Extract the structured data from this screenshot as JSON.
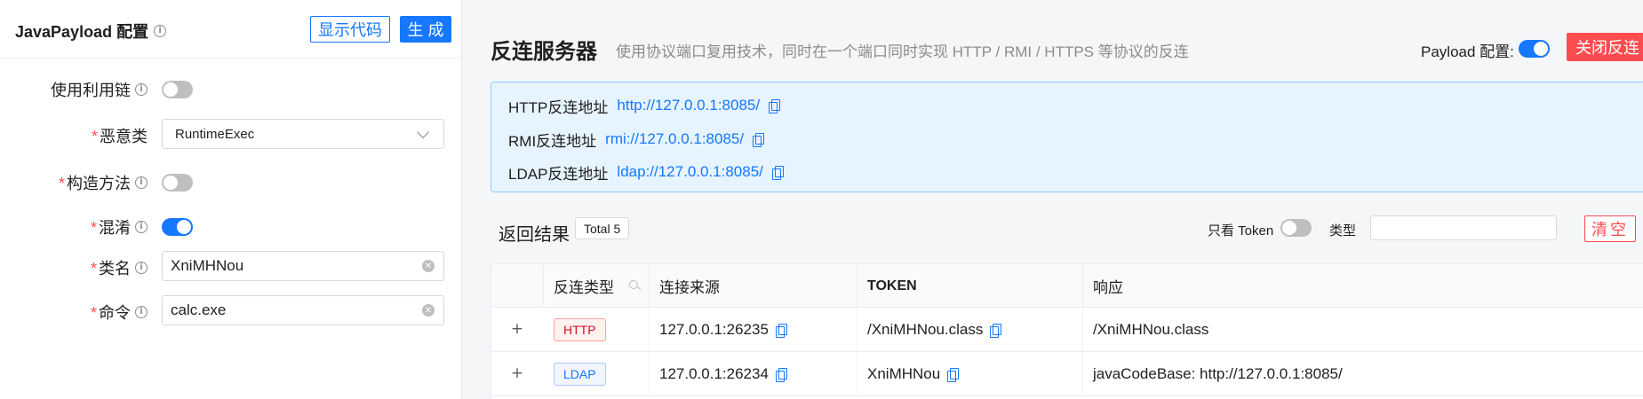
{
  "left_panel": {
    "title": "JavaPayload 配置",
    "show_code_label": "显示代码",
    "generate_label": "生 成",
    "fields": {
      "use_chain": {
        "label": "使用利用链",
        "required": false,
        "enabled": false
      },
      "malicious_class": {
        "label": "恶意类",
        "required": true,
        "value": "RuntimeExec"
      },
      "constructor": {
        "label": "构造方法",
        "required": true,
        "enabled": false
      },
      "obfuscate": {
        "label": "混淆",
        "required": true,
        "enabled": true
      },
      "class_name": {
        "label": "类名",
        "required": true,
        "value": "XniMHNou"
      },
      "command": {
        "label": "命令",
        "required": true,
        "value": "calc.exe"
      }
    }
  },
  "right_panel": {
    "title": "反连服务器",
    "description": "使用协议端口复用技术，同时在一个端口同时实现 HTTP / RMI / HTTPS 等协议的反连",
    "payload_config_label": "Payload 配置:",
    "payload_config_enabled": true,
    "close_button_label": "关闭反连",
    "addresses": [
      {
        "label": "HTTP反连地址",
        "url": "http://127.0.0.1:8085/"
      },
      {
        "label": "RMI反连地址",
        "url": "rmi://127.0.0.1:8085/"
      },
      {
        "label": "LDAP反连地址",
        "url": "ldap://127.0.0.1:8085/"
      }
    ],
    "results": {
      "title": "返回结果",
      "total_label": "Total 5",
      "only_token_label": "只看 Token",
      "only_token_enabled": false,
      "type_label": "类型",
      "type_value": "",
      "clear_label": "清空",
      "columns": [
        "反连类型",
        "连接来源",
        "TOKEN",
        "响应"
      ],
      "rows": [
        {
          "type": "HTTP",
          "source": "127.0.0.1:26235",
          "token": "/XniMHNou.class",
          "response": "/XniMHNou.class"
        },
        {
          "type": "LDAP",
          "source": "127.0.0.1:26234",
          "token": "XniMHNou",
          "response": "javaCodeBase: http://127.0.0.1:8085/"
        }
      ]
    }
  },
  "colors": {
    "primary": "#1677ff",
    "danger": "#ff4d4f",
    "info_bg": "#e6f4ff"
  },
  "icons": {
    "info": "info-icon",
    "copy": "copy-icon",
    "clear": "clear-icon",
    "search": "search-icon",
    "expand": "plus-icon",
    "dropdown": "chevron-down-icon"
  }
}
